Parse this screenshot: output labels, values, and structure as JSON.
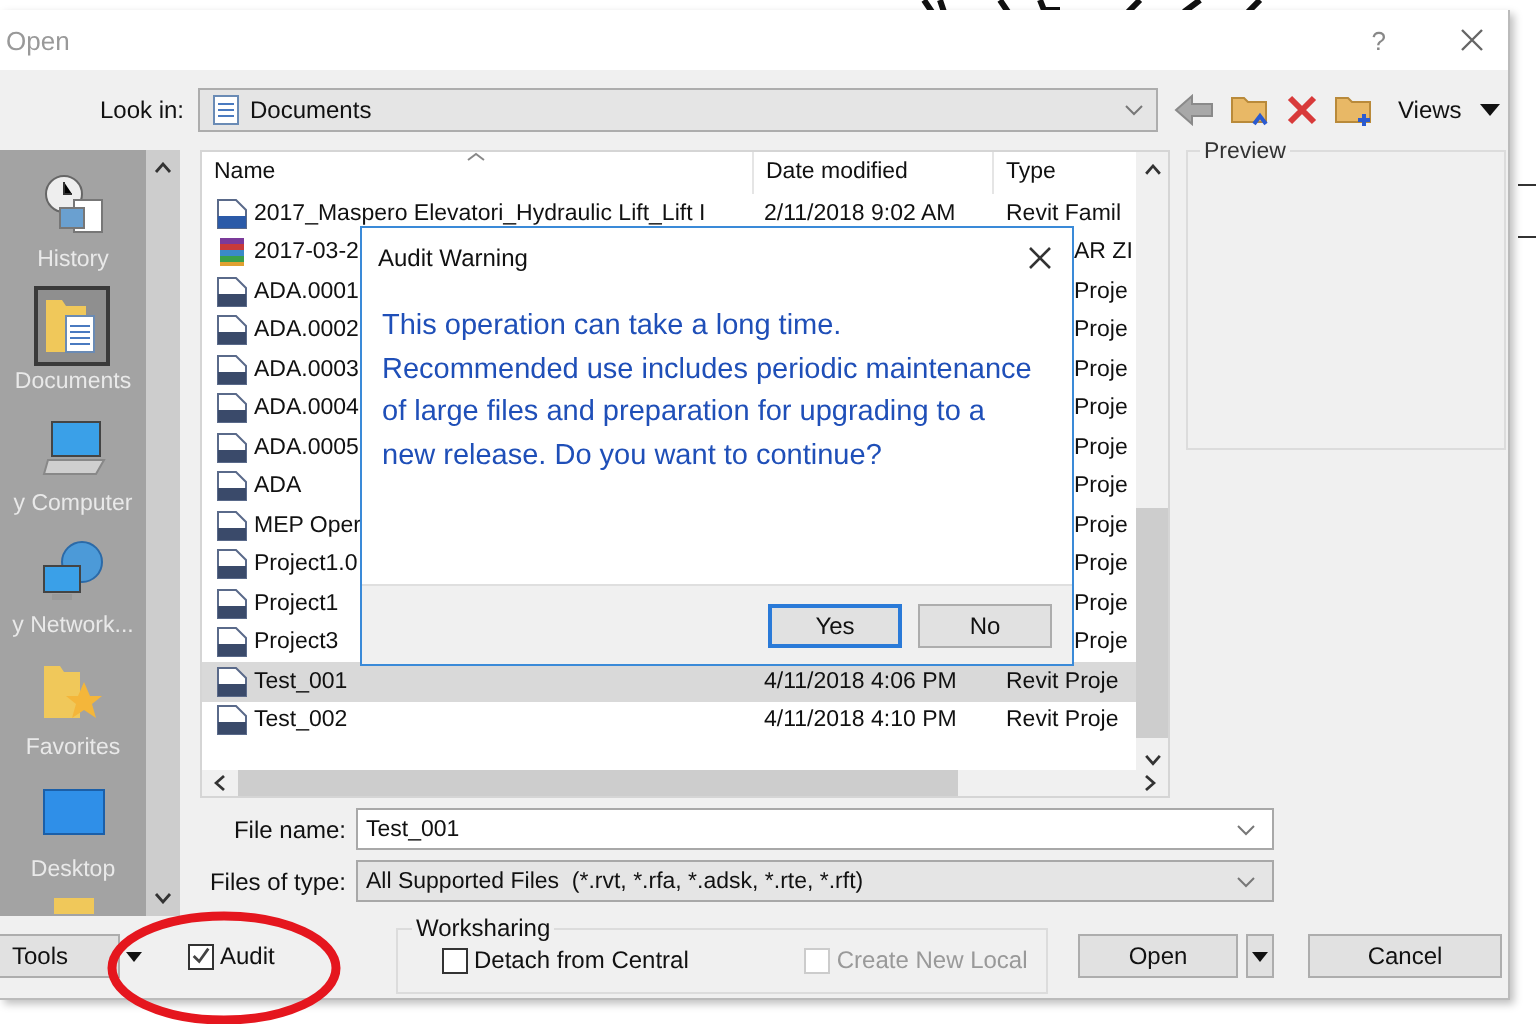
{
  "dialog": {
    "title": "Open",
    "help": "?"
  },
  "look_in": {
    "label": "Look in:",
    "value": "Documents"
  },
  "toolbar": {
    "views": "Views"
  },
  "places": [
    {
      "label": "History",
      "kind": "history",
      "selected": false
    },
    {
      "label": "Documents",
      "kind": "documents",
      "selected": true
    },
    {
      "label": "y Computer",
      "kind": "computer",
      "selected": false
    },
    {
      "label": "y Network...",
      "kind": "network",
      "selected": false
    },
    {
      "label": "Favorites",
      "kind": "favorites",
      "selected": false
    },
    {
      "label": "Desktop",
      "kind": "desktop",
      "selected": false
    }
  ],
  "file_list": {
    "columns": [
      "Name",
      "Date modified",
      "Type"
    ],
    "rows": [
      {
        "name": "2017_Maspero Elevatori_Hydraulic Lift_Lift I",
        "date": "2/11/2018 9:02 AM",
        "type": "Revit Famil",
        "kind": "rfa",
        "selected": false
      },
      {
        "name": "2017-03-2",
        "type": "AR ZI",
        "kind": "archive",
        "selected": false
      },
      {
        "name": "ADA.0001",
        "type": "Proje",
        "kind": "rvt",
        "selected": false
      },
      {
        "name": "ADA.0002",
        "type": "Proje",
        "kind": "rvt",
        "selected": false
      },
      {
        "name": "ADA.0003",
        "type": "Proje",
        "kind": "rvt",
        "selected": false
      },
      {
        "name": "ADA.0004",
        "type": "Proje",
        "kind": "rvt",
        "selected": false
      },
      {
        "name": "ADA.0005",
        "type": "Proje",
        "kind": "rvt",
        "selected": false
      },
      {
        "name": "ADA",
        "type": "Proje",
        "kind": "rvt",
        "selected": false
      },
      {
        "name": "MEP Oper",
        "type": "Proje",
        "kind": "rvt",
        "selected": false
      },
      {
        "name": "Project1.0",
        "type": "Proje",
        "kind": "rvt",
        "selected": false
      },
      {
        "name": "Project1",
        "type": "Proje",
        "kind": "rvt",
        "selected": false
      },
      {
        "name": "Project3",
        "type": "Proje",
        "kind": "rvt",
        "selected": false
      },
      {
        "name": "Test_001",
        "date": "4/11/2018 4:06 PM",
        "type": "Revit Proje",
        "kind": "rvt",
        "selected": true
      },
      {
        "name": "Test_002",
        "date": "4/11/2018 4:10 PM",
        "type": "Revit Proje",
        "kind": "rvt",
        "selected": false
      }
    ]
  },
  "preview": {
    "label": "Preview"
  },
  "file_name": {
    "label": "File name:",
    "value": "Test_001"
  },
  "file_type": {
    "label": "Files of type:",
    "value": "All Supported Files  (*.rvt, *.rfa, *.adsk, *.rte, *.rft)"
  },
  "tools": {
    "label": "Tools"
  },
  "audit": {
    "label": "Audit",
    "checked": true
  },
  "worksharing": {
    "title": "Worksharing",
    "options": [
      {
        "label": "Detach from Central",
        "checked": false,
        "disabled": false
      },
      {
        "label": "Create New Local",
        "checked": false,
        "disabled": true
      }
    ]
  },
  "buttons": {
    "open": "Open",
    "cancel": "Cancel"
  },
  "audit_warning": {
    "title": "Audit Warning",
    "message": "This operation can take a long time.\nRecommended use includes periodic maintenance of large files and preparation for upgrading to a new release. Do you want to continue?",
    "buttons": [
      {
        "label": "Yes",
        "default": true
      },
      {
        "label": "No",
        "default": false
      }
    ]
  }
}
